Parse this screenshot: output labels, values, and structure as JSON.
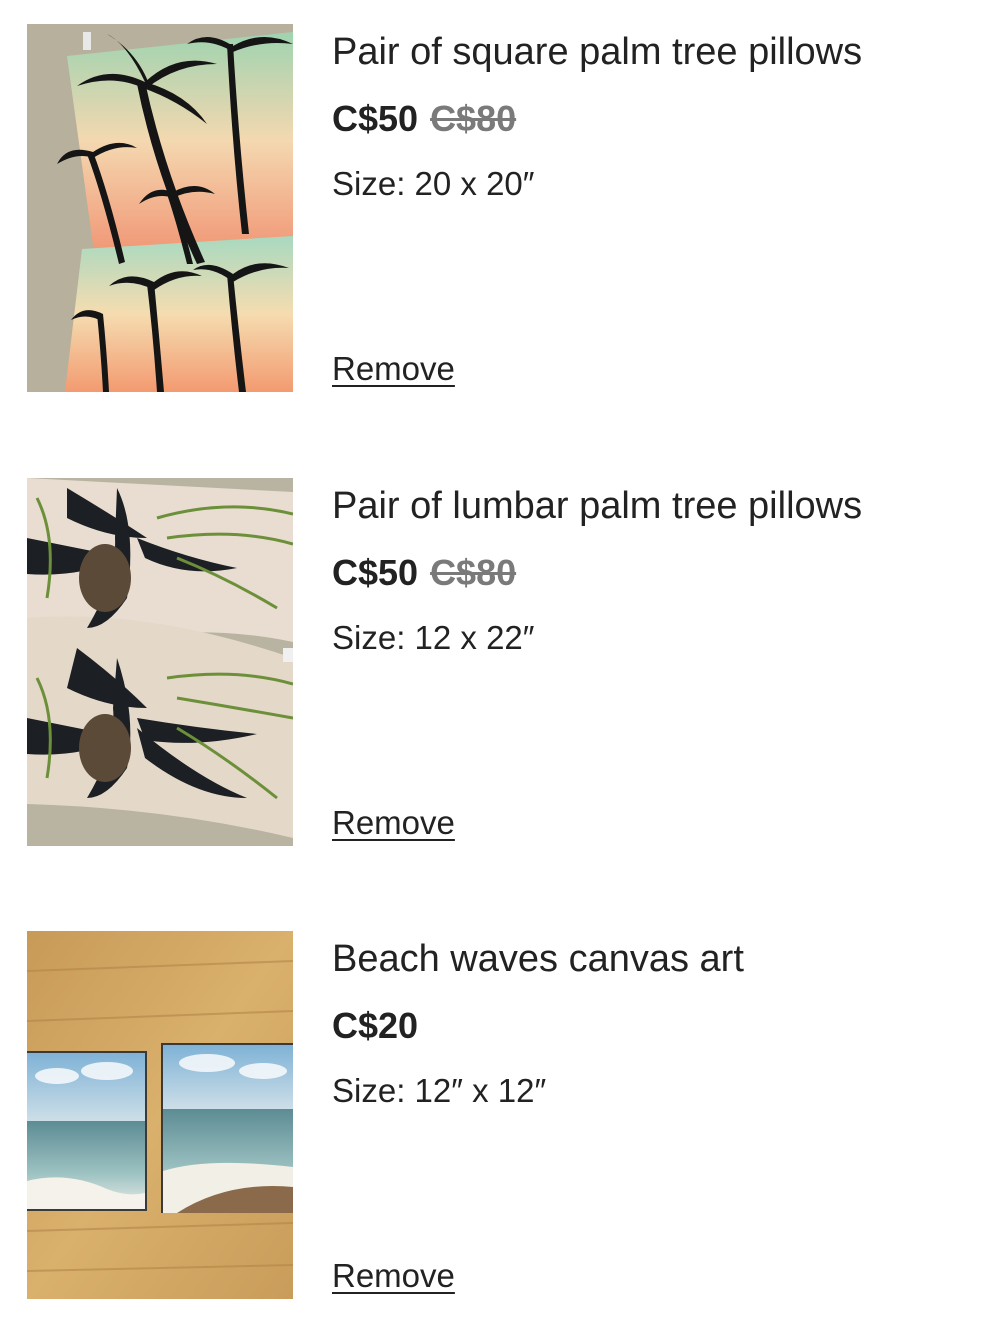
{
  "cart": {
    "items": [
      {
        "title": "Pair of square palm tree pillows",
        "price": "C$50",
        "original_price": "C$80",
        "size": "Size: 20 x 20″",
        "remove_label": "Remove",
        "image_alt": "square palm tree pillows photo"
      },
      {
        "title": "Pair of lumbar palm tree pillows",
        "price": "C$50",
        "original_price": "C$80",
        "size": "Size: 12 x 22″",
        "remove_label": "Remove",
        "image_alt": "lumbar palm tree pillows photo"
      },
      {
        "title": "Beach waves canvas art",
        "price": "C$20",
        "size": "Size: 12″ x 12″",
        "remove_label": "Remove",
        "image_alt": "beach waves canvas art photo"
      }
    ]
  },
  "colors": {
    "text": "#222222",
    "strikethrough_price": "#7a7a7a",
    "background": "#ffffff"
  }
}
